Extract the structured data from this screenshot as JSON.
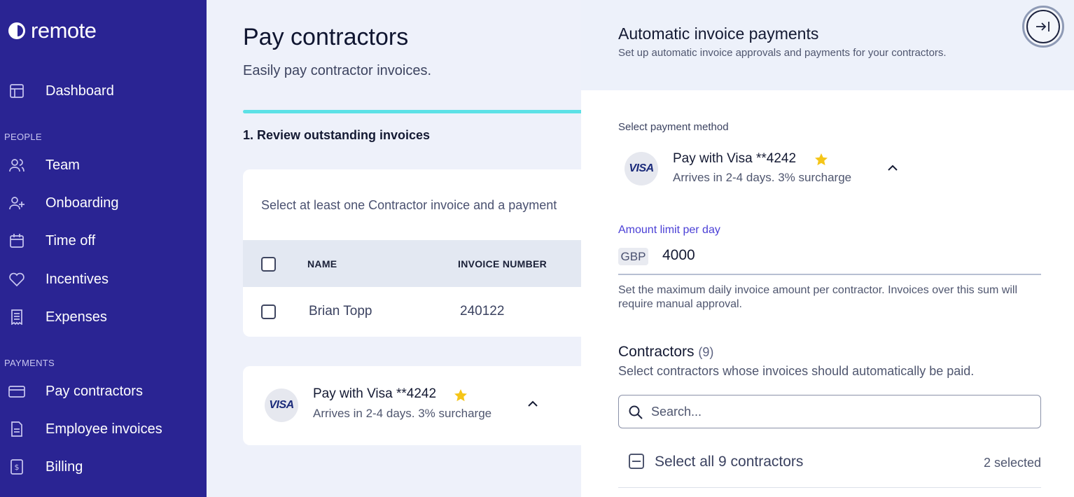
{
  "brand": {
    "name": "remote"
  },
  "sidebar": {
    "items": [
      {
        "label": "Dashboard",
        "icon": "layout-icon"
      },
      {
        "label": "Team",
        "icon": "users-icon"
      },
      {
        "label": "Onboarding",
        "icon": "user-plus-icon"
      },
      {
        "label": "Time off",
        "icon": "calendar-icon"
      },
      {
        "label": "Incentives",
        "icon": "heart-icon"
      },
      {
        "label": "Expenses",
        "icon": "receipt-icon"
      },
      {
        "label": "Pay contractors",
        "icon": "credit-card-icon"
      },
      {
        "label": "Employee invoices",
        "icon": "invoice-icon"
      },
      {
        "label": "Billing",
        "icon": "billing-icon"
      }
    ],
    "sections": {
      "people": "PEOPLE",
      "payments": "PAYMENTS"
    }
  },
  "main": {
    "title": "Pay contractors",
    "subtitle": "Easily pay contractor invoices.",
    "step_label": "1. Review outstanding invoices",
    "hint": "Select at least one Contractor invoice and a payment",
    "table": {
      "headers": [
        "NAME",
        "INVOICE NUMBER"
      ],
      "rows": [
        {
          "name": "Brian Topp",
          "invoice_number": "240122"
        }
      ]
    },
    "payment_method": {
      "brand": "VISA",
      "title": "Pay with Visa **4242",
      "subtitle": "Arrives in 2-4 days. 3% surcharge"
    }
  },
  "drawer": {
    "title": "Automatic invoice payments",
    "subtitle": "Set up automatic invoice approvals and payments for your contractors.",
    "payment_method_label": "Select payment method",
    "payment_method": {
      "brand": "VISA",
      "title": "Pay with Visa **4242",
      "subtitle": "Arrives in 2-4 days. 3% surcharge"
    },
    "amount": {
      "label": "Amount limit per day",
      "currency": "GBP",
      "value": "4000",
      "help": "Set the maximum daily invoice amount per contractor. Invoices over this sum will require manual approval."
    },
    "contractors": {
      "title": "Contractors",
      "count": "(9)",
      "subtitle": "Select contractors whose invoices should automatically be paid.",
      "search_placeholder": "Search...",
      "select_all_label": "Select all 9 contractors",
      "selected_count": "2 selected"
    }
  },
  "colors": {
    "sidebar_bg": "#2a2493",
    "accent": "#4a3fd6",
    "progress": "#5ce1e6",
    "star": "#f5c518"
  }
}
